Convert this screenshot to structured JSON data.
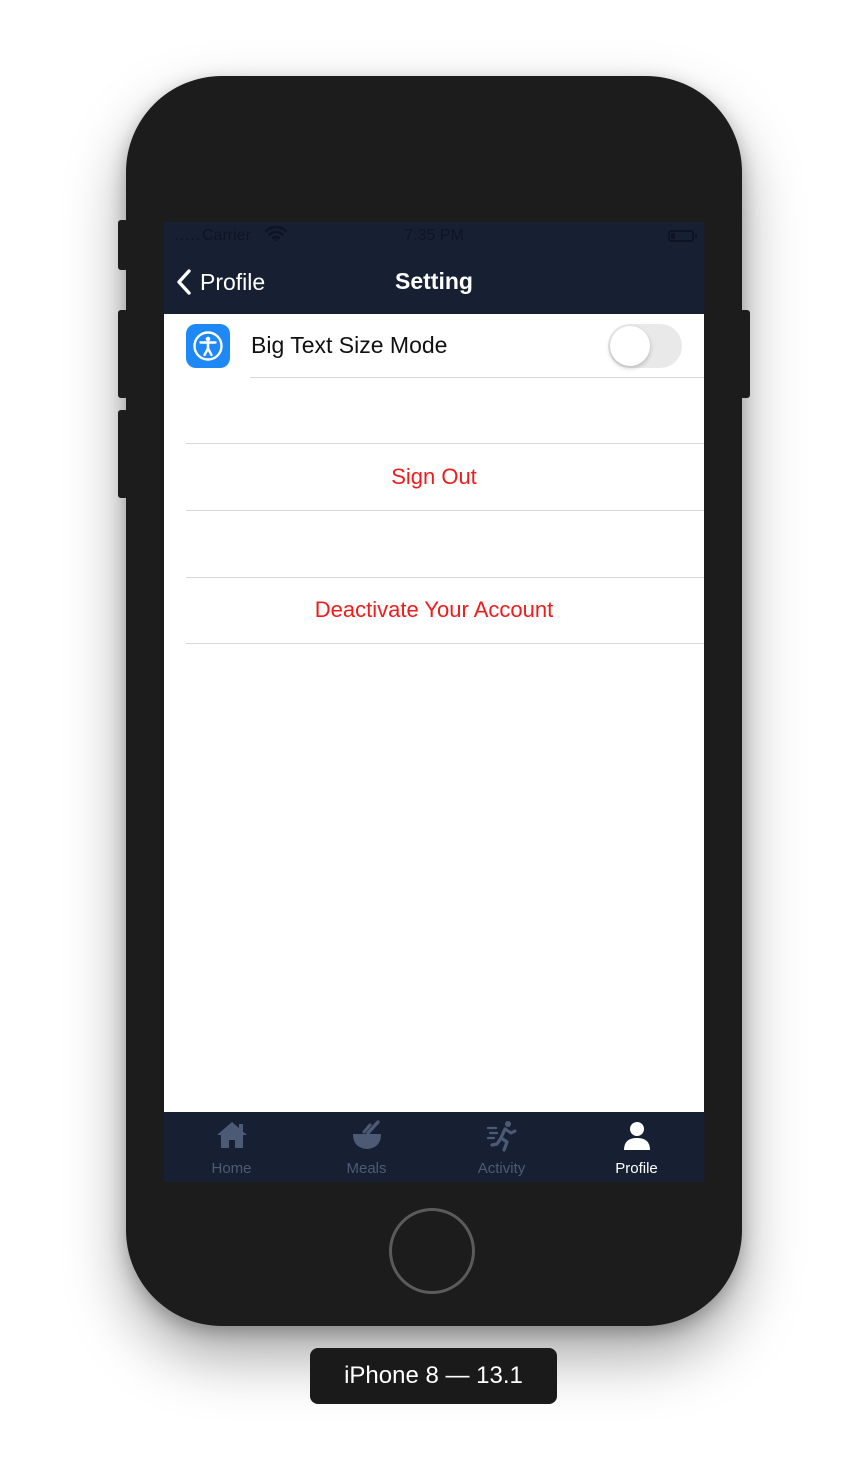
{
  "status_bar": {
    "carrier": "Carrier",
    "time": "7:35 PM",
    "signal_dots": "....."
  },
  "nav": {
    "back_label": "Profile",
    "title": "Setting"
  },
  "settings": {
    "big_text": {
      "label": "Big Text Size Mode",
      "icon": "accessibility-icon",
      "enabled": false
    },
    "sign_out_label": "Sign Out",
    "deactivate_label": "Deactivate Your Account"
  },
  "tabs": [
    {
      "label": "Home",
      "icon": "home-icon",
      "active": false
    },
    {
      "label": "Meals",
      "icon": "bowl-icon",
      "active": false
    },
    {
      "label": "Activity",
      "icon": "running-icon",
      "active": false
    },
    {
      "label": "Profile",
      "icon": "user-icon",
      "active": true
    }
  ],
  "device_label": "iPhone 8 — 13.1",
  "colors": {
    "nav_bg": "#172033",
    "destructive_red": "#ee1c1c",
    "accent_blue": "#1e88f5",
    "tab_inactive": "#4d5a76",
    "tab_active": "#ffffff"
  }
}
